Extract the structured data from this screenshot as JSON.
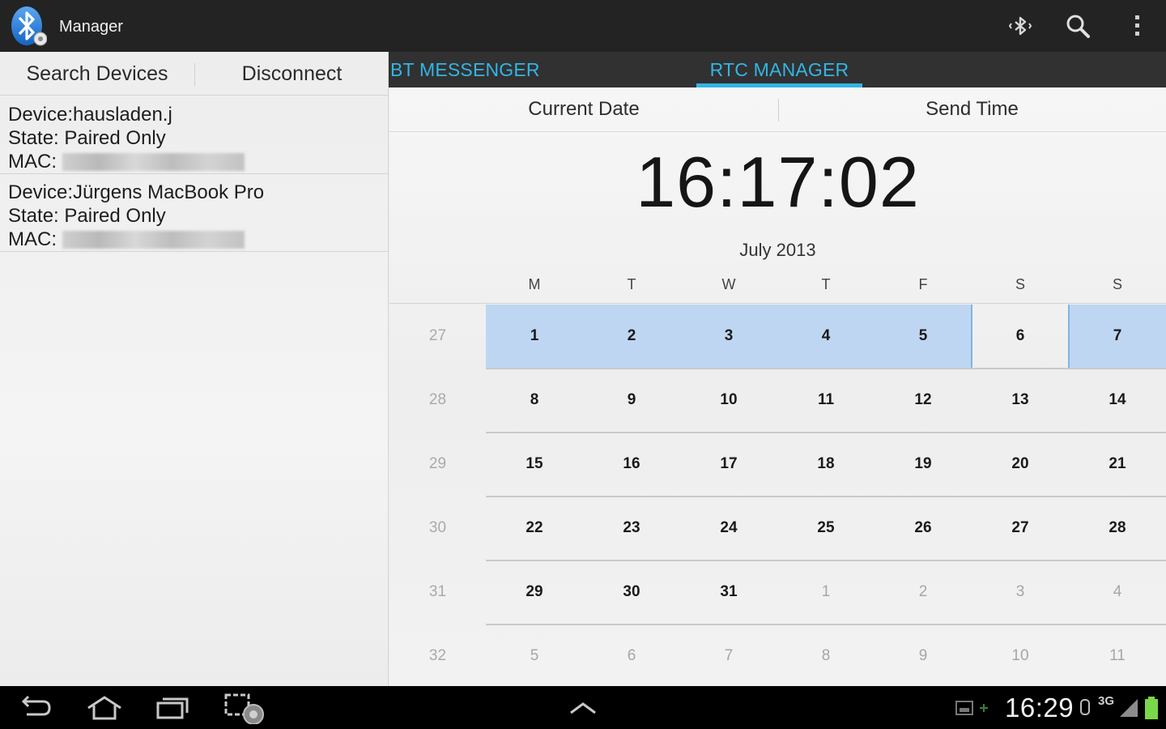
{
  "actionbar": {
    "title": "Manager",
    "icons": [
      "bluetooth-icon",
      "bluetooth-scan-icon",
      "search-icon",
      "overflow-menu-icon"
    ]
  },
  "left": {
    "search_label": "Search Devices",
    "disconnect_label": "Disconnect",
    "devices": [
      {
        "name": "Device:hausladen.j",
        "state": "State: Paired Only",
        "mac_label": "MAC:"
      },
      {
        "name": "Device:Jürgens MacBook Pro",
        "state": "State: Paired Only",
        "mac_label": "MAC:"
      }
    ]
  },
  "tabs": [
    {
      "label": "BT MESSENGER",
      "selected": false
    },
    {
      "label": "RTC MANAGER",
      "selected": true
    }
  ],
  "accent_color": "#33b5e5",
  "rtc": {
    "current_date_label": "Current Date",
    "send_time_label": "Send Time",
    "time": "16:17:02",
    "month": "July 2013",
    "weekdays": [
      "M",
      "T",
      "W",
      "T",
      "F",
      "S",
      "S"
    ],
    "weeks": [
      {
        "no": "27",
        "days": [
          "1",
          "2",
          "3",
          "4",
          "5",
          "6",
          "7"
        ]
      },
      {
        "no": "28",
        "days": [
          "8",
          "9",
          "10",
          "11",
          "12",
          "13",
          "14"
        ]
      },
      {
        "no": "29",
        "days": [
          "15",
          "16",
          "17",
          "18",
          "19",
          "20",
          "21"
        ]
      },
      {
        "no": "30",
        "days": [
          "22",
          "23",
          "24",
          "25",
          "26",
          "27",
          "28"
        ]
      },
      {
        "no": "31",
        "days": [
          "29",
          "30",
          "31",
          "1",
          "2",
          "3",
          "4"
        ]
      },
      {
        "no": "32",
        "days": [
          "5",
          "6",
          "7",
          "8",
          "9",
          "10",
          "11"
        ]
      }
    ],
    "selection_color": "#bfd6f2"
  },
  "systembar": {
    "time": "16:29",
    "icons": [
      "back-icon",
      "home-icon",
      "recent-apps-icon",
      "screenshot-icon",
      "up-chevron-icon",
      "sd-card-icon",
      "battery-icon",
      "signal-icon"
    ],
    "network": "3G"
  }
}
